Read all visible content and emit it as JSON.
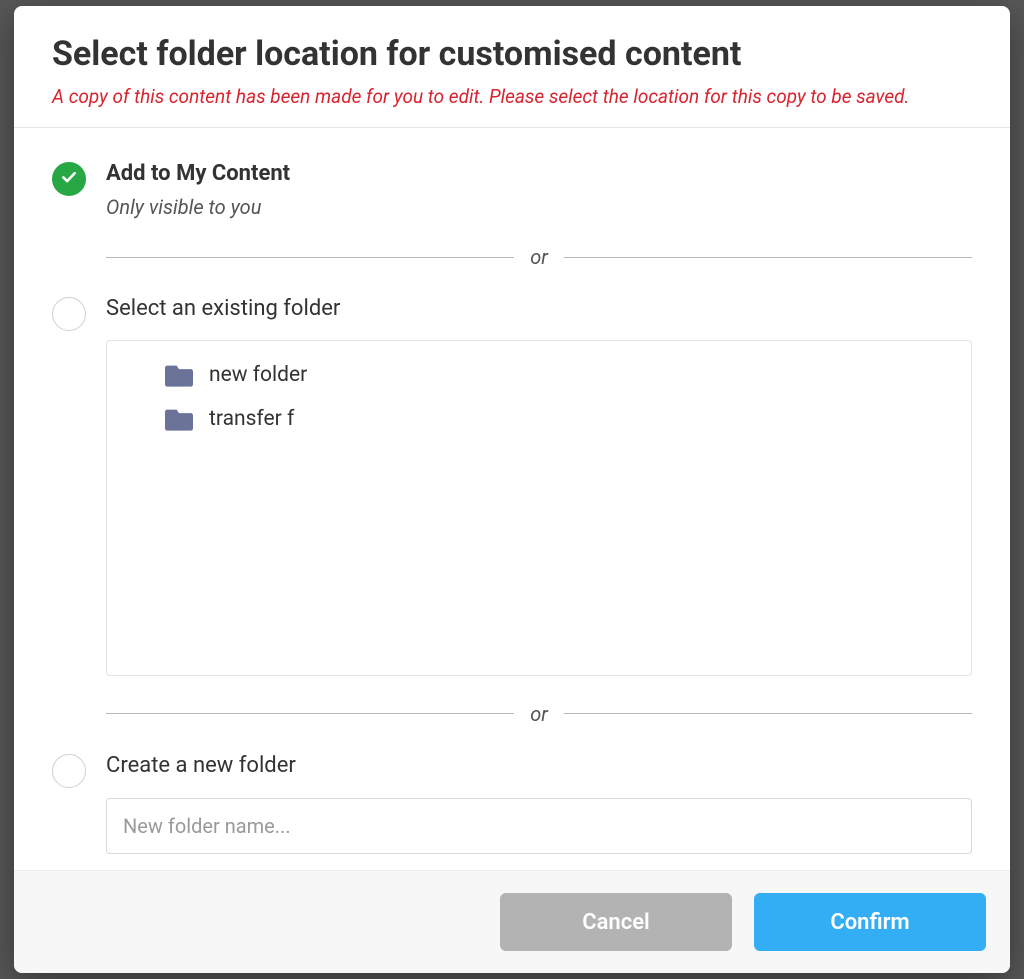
{
  "modal": {
    "title": "Select folder location for customised content",
    "subtitle": "A copy of this content has been made for you to edit. Please select the location for this copy to be saved."
  },
  "options": {
    "my_content": {
      "title": "Add to My Content",
      "desc": "Only visible to you"
    },
    "existing": {
      "title": "Select an existing folder"
    },
    "new_folder": {
      "title": "Create a new folder",
      "placeholder": "New folder name..."
    }
  },
  "divider_text": "or",
  "folders": [
    {
      "label": "new folder"
    },
    {
      "label": "transfer f"
    }
  ],
  "buttons": {
    "cancel": "Cancel",
    "confirm": "Confirm"
  }
}
